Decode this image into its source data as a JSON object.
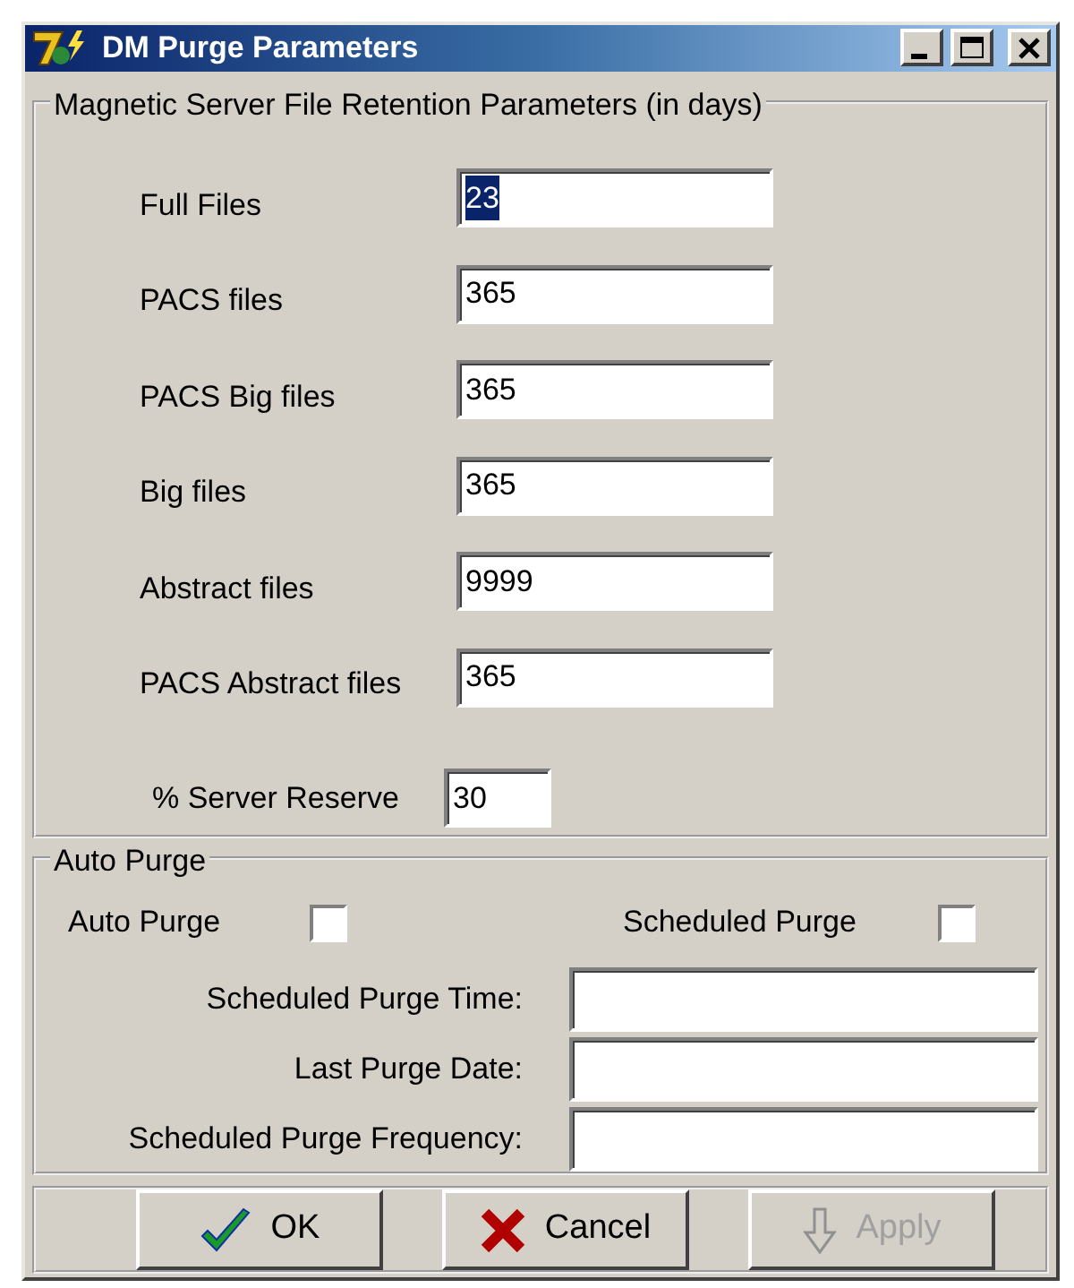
{
  "window": {
    "title": "DM Purge Parameters"
  },
  "retention": {
    "title": "Magnetic Server File Retention Parameters (in days)",
    "fields": [
      {
        "label": "Full Files",
        "value": "23",
        "text_selected": true
      },
      {
        "label": "PACS files",
        "value": "365",
        "text_selected": false
      },
      {
        "label": "PACS Big files",
        "value": "365",
        "text_selected": false
      },
      {
        "label": "Big files",
        "value": "365",
        "text_selected": false
      },
      {
        "label": "Abstract files",
        "value": "9999",
        "text_selected": false
      },
      {
        "label": "PACS Abstract files",
        "value": "365",
        "text_selected": false
      }
    ],
    "reserve": {
      "label": "% Server Reserve",
      "value": "30"
    }
  },
  "auto_purge": {
    "title": "Auto Purge",
    "checkboxes": [
      {
        "label": "Auto Purge",
        "checked": false
      },
      {
        "label": "Scheduled Purge",
        "checked": false
      }
    ],
    "fields": [
      {
        "label": "Scheduled Purge Time:"
      },
      {
        "label": "Last Purge Date:"
      },
      {
        "label": "Scheduled Purge Frequency:"
      }
    ]
  },
  "buttons": [
    {
      "kind": "ok",
      "label": "OK",
      "disabled": false
    },
    {
      "kind": "cancel",
      "label": "Cancel",
      "disabled": false
    },
    {
      "kind": "apply",
      "label": "Apply",
      "disabled": true
    }
  ]
}
